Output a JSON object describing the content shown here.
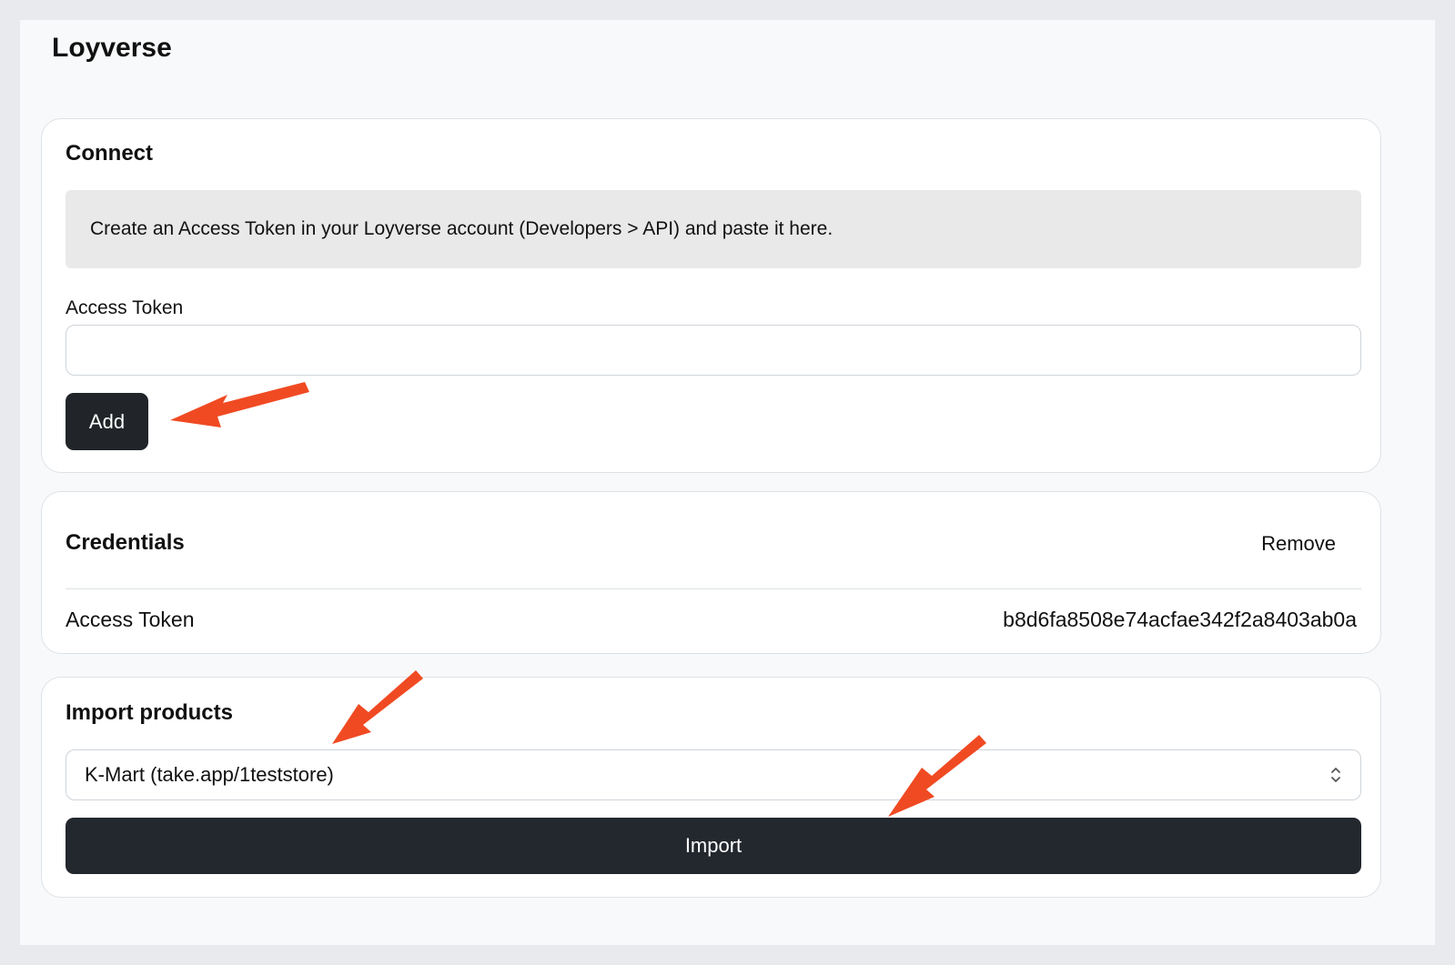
{
  "app": {
    "title": "Loyverse"
  },
  "connect": {
    "title": "Connect",
    "info": "Create an Access Token in your Loyverse account (Developers > API) and paste it here.",
    "token_label": "Access Token",
    "token_value": "",
    "add_label": "Add"
  },
  "credentials": {
    "title": "Credentials",
    "remove_label": "Remove",
    "token_label": "Access Token",
    "token_value": "b8d6fa8508e74acfae342f2a8403ab0a"
  },
  "import": {
    "title": "Import products",
    "selected_store": "K-Mart (take.app/1teststore)",
    "import_label": "Import"
  },
  "icons": {
    "select_indicator": "chevron-up-down-icon",
    "annotation": "arrow-icon"
  },
  "colors": {
    "page_background": "#e8eaee",
    "panel_background": "#f8f9fa",
    "card_background": "#ffffff",
    "info_background": "#e9e9e9",
    "button_dark": "#212529",
    "annotation_arrow": "#f04a23"
  }
}
